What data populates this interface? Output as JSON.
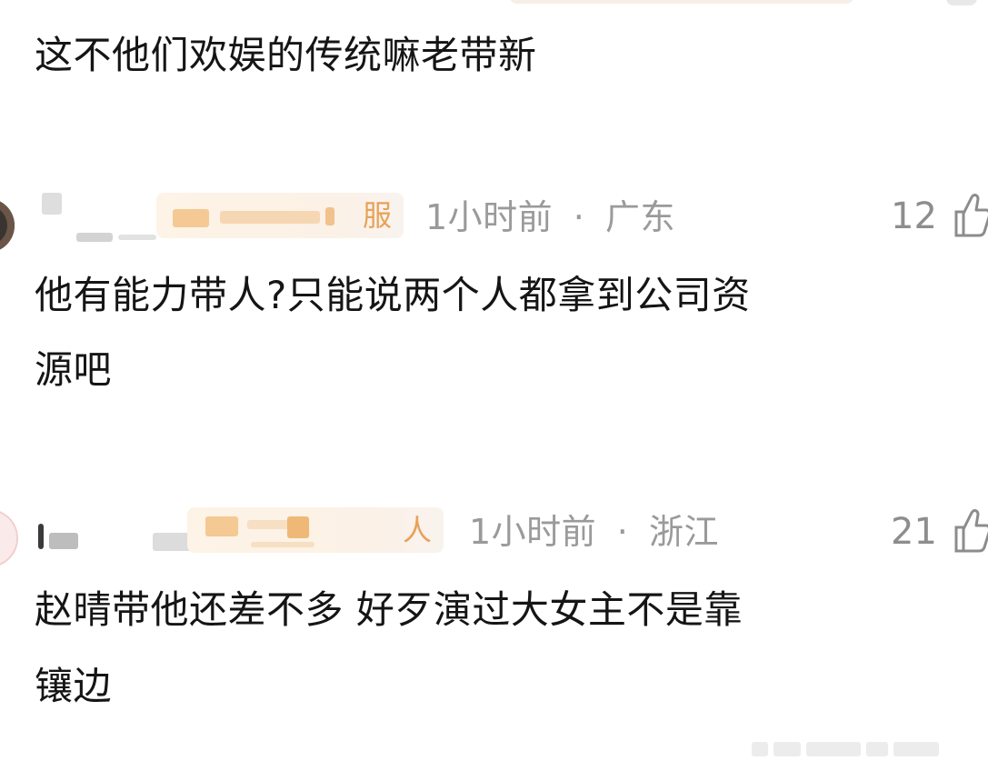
{
  "comments": [
    {
      "text": "这不他们欢娱的传统嘛老带新"
    },
    {
      "user_badge": "服",
      "time": "1小时前",
      "separator": "·",
      "location": "广东",
      "likes": "12",
      "text_line1": "他有能力带人?只能说两个人都拿到公司资",
      "text_line2": "源吧"
    },
    {
      "user_badge": "人",
      "time": "1小时前",
      "separator": "·",
      "location": "浙江",
      "likes": "21",
      "text_line1": "赵晴带他还差不多 好歹演过大女主不是靠",
      "text_line2": "镶边"
    }
  ],
  "icons": {
    "like": "thumbs-up-icon",
    "avatar": "avatar"
  },
  "colors": {
    "badge_text": "#e8a257",
    "meta_text": "#9a9a9a"
  }
}
